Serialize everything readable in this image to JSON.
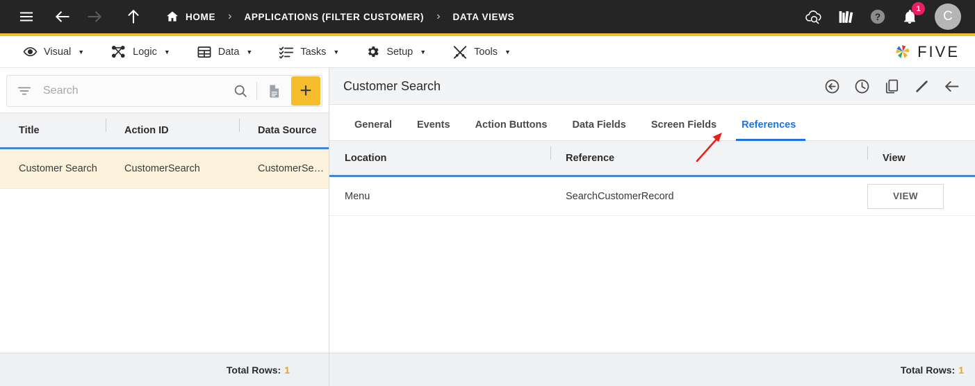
{
  "topbar": {
    "menu_icon": "hamburger-icon",
    "back_icon": "arrow-left-icon",
    "forward_icon": "arrow-right-icon",
    "up_icon": "arrow-up-icon",
    "breadcrumbs": [
      {
        "label": "HOME",
        "icon": "home-icon"
      },
      {
        "label": "APPLICATIONS (FILTER CUSTOMER)",
        "icon": ""
      },
      {
        "label": "DATA VIEWS",
        "icon": ""
      }
    ],
    "separator": "›",
    "actions": [
      {
        "name": "cloud-search-icon"
      },
      {
        "name": "library-books-icon"
      },
      {
        "name": "help-icon"
      },
      {
        "name": "notifications-icon",
        "badge": "1"
      }
    ],
    "avatar_initial": "C",
    "accent_color": "#F5BC2C",
    "background_color": "#252525"
  },
  "menubar": {
    "items": [
      {
        "label": "Visual",
        "icon": "eye-icon",
        "caret": "▼"
      },
      {
        "label": "Logic",
        "icon": "logic-graph-icon",
        "caret": "▼"
      },
      {
        "label": "Data",
        "icon": "table-grid-icon",
        "caret": "▼"
      },
      {
        "label": "Tasks",
        "icon": "checklist-icon",
        "caret": "▼"
      },
      {
        "label": "Setup",
        "icon": "gear-icon",
        "caret": "▼"
      },
      {
        "label": "Tools",
        "icon": "tools-icon",
        "caret": "▼"
      }
    ],
    "brand": "FIVE"
  },
  "left_panel": {
    "search": {
      "placeholder": "Search",
      "value": "",
      "filter_icon": "filter-icon",
      "search_icon": "search-icon",
      "document_icon": "document-icon",
      "add_label": "+",
      "add_color": "#F5BC2C"
    },
    "table": {
      "columns": [
        "Title",
        "Action ID",
        "Data Source"
      ],
      "rows": [
        {
          "title": "Customer Search",
          "action_id": "CustomerSearch",
          "data_source": "CustomerSearch…",
          "selected": true
        }
      ]
    },
    "footer": {
      "label": "Total Rows:",
      "count": "1"
    }
  },
  "right_panel": {
    "title": "Customer Search",
    "header_actions": [
      {
        "name": "undo-circle-icon"
      },
      {
        "name": "history-clock-icon"
      },
      {
        "name": "copy-icon"
      },
      {
        "name": "edit-pencil-icon"
      },
      {
        "name": "back-arrow-icon"
      }
    ],
    "tabs": [
      {
        "label": "General",
        "active": false
      },
      {
        "label": "Events",
        "active": false
      },
      {
        "label": "Action Buttons",
        "active": false
      },
      {
        "label": "Data Fields",
        "active": false
      },
      {
        "label": "Screen Fields",
        "active": false
      },
      {
        "label": "References",
        "active": true
      }
    ],
    "table": {
      "columns": [
        "Location",
        "Reference",
        "View"
      ],
      "rows": [
        {
          "location": "Menu",
          "reference": "SearchCustomerRecord",
          "view_label": "VIEW"
        }
      ]
    },
    "footer": {
      "label": "Total Rows:",
      "count": "1"
    }
  },
  "annotation": {
    "type": "arrow",
    "color": "#E8201B",
    "points_to": "References tab"
  }
}
